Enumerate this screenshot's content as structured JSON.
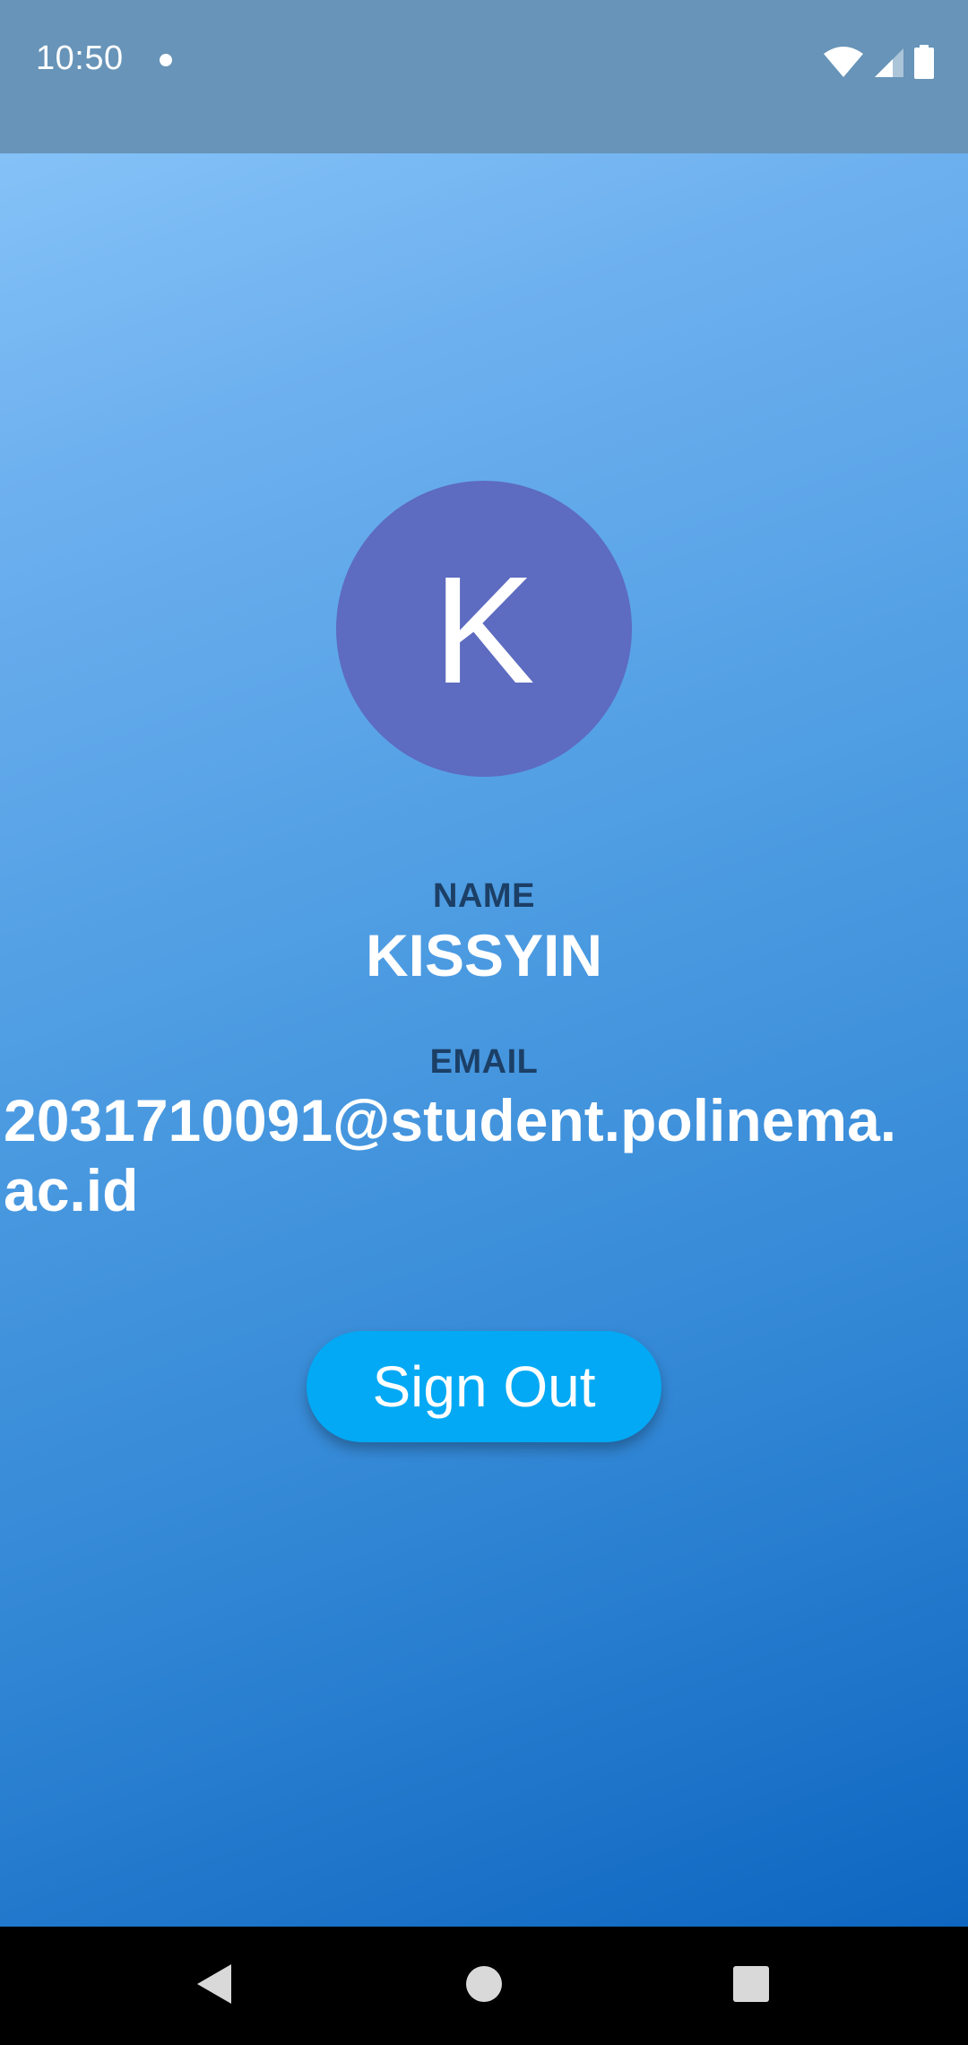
{
  "status_bar": {
    "time": "10:50",
    "icons": [
      "notification-dot-icon",
      "wifi-icon",
      "cellular-signal-icon",
      "battery-icon"
    ]
  },
  "profile": {
    "avatar_letter": "K",
    "avatar_color": "#5d6bc0",
    "name_label": "NAME",
    "name_value": "KISSYIN",
    "email_label": "EMAIL",
    "email_value": "2031710091@student.polinema.ac.id"
  },
  "actions": {
    "sign_out_label": "Sign Out",
    "sign_out_color": "#03a9f4"
  },
  "nav_bar": {
    "buttons": [
      "back-icon",
      "home-icon",
      "recents-icon"
    ]
  }
}
